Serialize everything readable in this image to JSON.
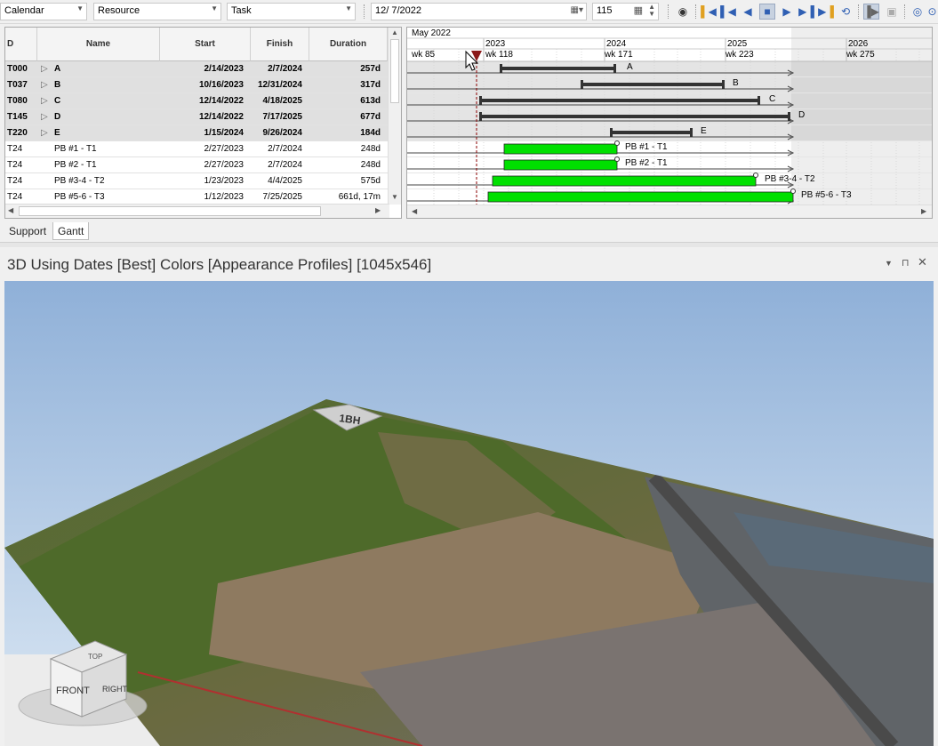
{
  "toolbar": {
    "calendar": "Calendar",
    "resource": "Resource",
    "task": "Task",
    "date": "12/ 7/2022",
    "number": "115"
  },
  "grid": {
    "columns": [
      "D",
      "Name",
      "Start",
      "Finish",
      "Duration"
    ],
    "rows": [
      {
        "id": "T000",
        "name": "A",
        "start": "2/14/2023",
        "finish": "2/7/2024",
        "duration": "257d",
        "summary": true
      },
      {
        "id": "T037",
        "name": "B",
        "start": "10/16/2023",
        "finish": "12/31/2024",
        "duration": "317d",
        "summary": true
      },
      {
        "id": "T080",
        "name": "C",
        "start": "12/14/2022",
        "finish": "4/18/2025",
        "duration": "613d",
        "summary": true
      },
      {
        "id": "T145",
        "name": "D",
        "start": "12/14/2022",
        "finish": "7/17/2025",
        "duration": "677d",
        "summary": true
      },
      {
        "id": "T220",
        "name": "E",
        "start": "1/15/2024",
        "finish": "9/26/2024",
        "duration": "184d",
        "summary": true
      },
      {
        "id": "T24",
        "name": "PB #1 - T1",
        "start": "2/27/2023",
        "finish": "2/7/2024",
        "duration": "248d",
        "summary": false
      },
      {
        "id": "T24",
        "name": "PB #2 - T1",
        "start": "2/27/2023",
        "finish": "2/7/2024",
        "duration": "248d",
        "summary": false
      },
      {
        "id": "T24",
        "name": "PB #3-4 - T2",
        "start": "1/23/2023",
        "finish": "4/4/2025",
        "duration": "575d",
        "summary": false
      },
      {
        "id": "T24",
        "name": "PB #5-6 - T3",
        "start": "1/12/2023",
        "finish": "7/25/2025",
        "duration": "661d, 17m",
        "summary": false
      }
    ]
  },
  "gantt": {
    "month": "May 2022",
    "years": [
      "2023",
      "2024",
      "2025",
      "2026"
    ],
    "weeks": [
      "wk 85",
      "wk 118",
      "wk 171",
      "wk 223",
      "wk 275"
    ],
    "bar_labels": [
      "A",
      "B",
      "C",
      "D",
      "E",
      "PB #1 - T1",
      "PB #2 - T1",
      "PB #3-4 - T2",
      "PB #5-6 - T3"
    ]
  },
  "tabs": [
    "Support",
    "Gantt"
  ],
  "panel": {
    "title": "3D Using Dates [Best] Colors [Appearance Profiles]  [1045x546]",
    "hole_label": "1BH",
    "viewcube": {
      "top": "TOP",
      "front": "FRONT",
      "right": "RIGHT"
    }
  },
  "colors": {
    "task_bar": "#00e000",
    "summary_bar": "#333333",
    "sky": "#a9c4e3"
  }
}
